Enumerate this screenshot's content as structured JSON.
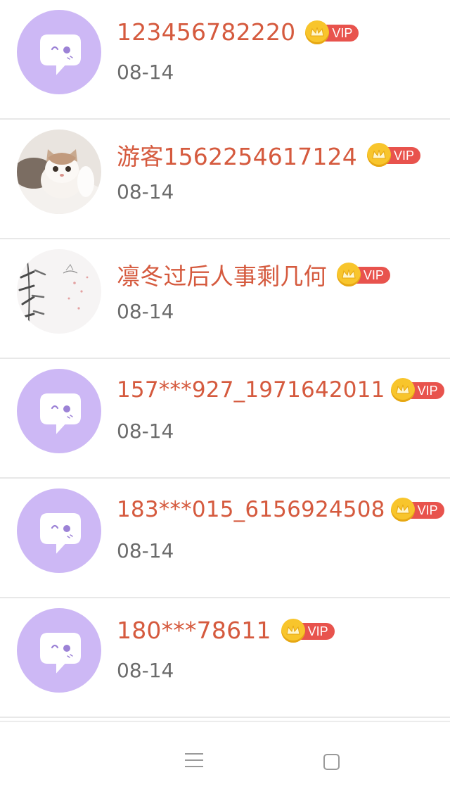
{
  "colors": {
    "name_text": "#d55a3e",
    "date_text": "#6b6b6b",
    "vip_badge": "#e8534d",
    "crown_badge": "#f8c52c",
    "default_avatar_bg": "#cdb8f5"
  },
  "users": [
    {
      "name": "123456782220",
      "date": "08-14",
      "vip": "VIP",
      "avatar": "default-chat-avatar-icon"
    },
    {
      "name": "游客1562254617124",
      "date": "08-14",
      "vip": "VIP",
      "avatar": "kitten-photo"
    },
    {
      "name": "凛冬过后人事剩几何",
      "date": "08-14",
      "vip": "VIP",
      "avatar": "ink-bamboo-painting"
    },
    {
      "name": "157***927_1971642011",
      "date": "08-14",
      "vip": "VIP",
      "avatar": "default-chat-avatar-icon"
    },
    {
      "name": "183***015_6156924508",
      "date": "08-14",
      "vip": "VIP",
      "avatar": "default-chat-avatar-icon"
    },
    {
      "name": "180***78611",
      "date": "08-14",
      "vip": "VIP",
      "avatar": "default-chat-avatar-icon"
    }
  ],
  "navbar": {
    "menu_icon": "menu-icon",
    "home_icon": "square-home-icon"
  }
}
